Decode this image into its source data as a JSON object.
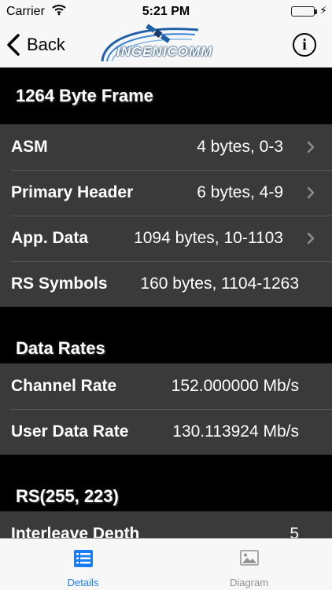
{
  "status_bar": {
    "carrier": "Carrier",
    "time": "5:21 PM"
  },
  "nav": {
    "back_label": "Back",
    "logo_text": "INGENICOMM",
    "info_label": "i"
  },
  "sections": [
    {
      "title": "1264 Byte Frame",
      "rows": [
        {
          "label": "ASM",
          "value": "4 bytes, 0-3",
          "chevron": true
        },
        {
          "label": "Primary Header",
          "value": "6 bytes, 4-9",
          "chevron": true
        },
        {
          "label": "App. Data",
          "value": "1094 bytes, 10-1103",
          "chevron": true
        },
        {
          "label": "RS Symbols",
          "value": "160 bytes, 1104-1263",
          "chevron": false
        }
      ]
    },
    {
      "title": "Data Rates",
      "rows": [
        {
          "label": "Channel Rate",
          "value": "152.000000 Mb/s",
          "chevron": false
        },
        {
          "label": "User Data Rate",
          "value": "130.113924 Mb/s",
          "chevron": false
        }
      ]
    },
    {
      "title": "RS(255, 223)",
      "rows": [
        {
          "label": "Interleave Depth",
          "value": "5",
          "chevron": false
        }
      ]
    }
  ],
  "tabs": [
    {
      "label": "Details",
      "active": true
    },
    {
      "label": "Diagram",
      "active": false
    }
  ],
  "colors": {
    "accent": "#1a7cf5",
    "inactive": "#929292",
    "row_bg": "#3a3a3a"
  }
}
